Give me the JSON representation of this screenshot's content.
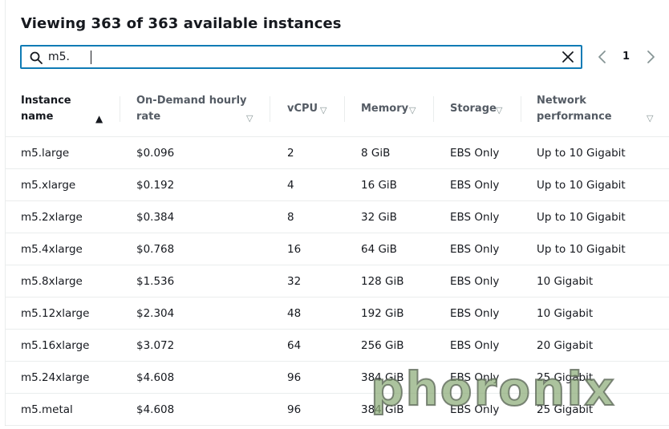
{
  "header": {
    "title": "Viewing 363 of 363 available instances"
  },
  "search": {
    "value": "m5.",
    "placeholder": ""
  },
  "pagination": {
    "current_page": "1"
  },
  "columns": [
    {
      "line1": "Instance",
      "line2": "name",
      "sort": "ascending"
    },
    {
      "line1": "On-Demand hourly",
      "line2": "rate",
      "sort": "none"
    },
    {
      "line1": "vCPU",
      "line2": "",
      "sort": "none"
    },
    {
      "line1": "Memory",
      "line2": "",
      "sort": "none"
    },
    {
      "line1": "Storage",
      "line2": "",
      "sort": "none"
    },
    {
      "line1": "Network",
      "line2": "performance",
      "sort": "none"
    }
  ],
  "rows": [
    [
      "m5.large",
      "$0.096",
      "2",
      "8 GiB",
      "EBS Only",
      "Up to 10 Gigabit"
    ],
    [
      "m5.xlarge",
      "$0.192",
      "4",
      "16 GiB",
      "EBS Only",
      "Up to 10 Gigabit"
    ],
    [
      "m5.2xlarge",
      "$0.384",
      "8",
      "32 GiB",
      "EBS Only",
      "Up to 10 Gigabit"
    ],
    [
      "m5.4xlarge",
      "$0.768",
      "16",
      "64 GiB",
      "EBS Only",
      "Up to 10 Gigabit"
    ],
    [
      "m5.8xlarge",
      "$1.536",
      "32",
      "128 GiB",
      "EBS Only",
      "10 Gigabit"
    ],
    [
      "m5.12xlarge",
      "$2.304",
      "48",
      "192 GiB",
      "EBS Only",
      "10 Gigabit"
    ],
    [
      "m5.16xlarge",
      "$3.072",
      "64",
      "256 GiB",
      "EBS Only",
      "20 Gigabit"
    ],
    [
      "m5.24xlarge",
      "$4.608",
      "96",
      "384 GiB",
      "EBS Only",
      "25 Gigabit"
    ],
    [
      "m5.metal",
      "$4.608",
      "96",
      "384 GiB",
      "EBS Only",
      "25 Gigabit"
    ]
  ],
  "watermark": {
    "text": "phoronix"
  },
  "colors": {
    "accent": "#0f7bb5",
    "text": "#16191f",
    "muted": "#545b64",
    "border": "#eaeded"
  }
}
